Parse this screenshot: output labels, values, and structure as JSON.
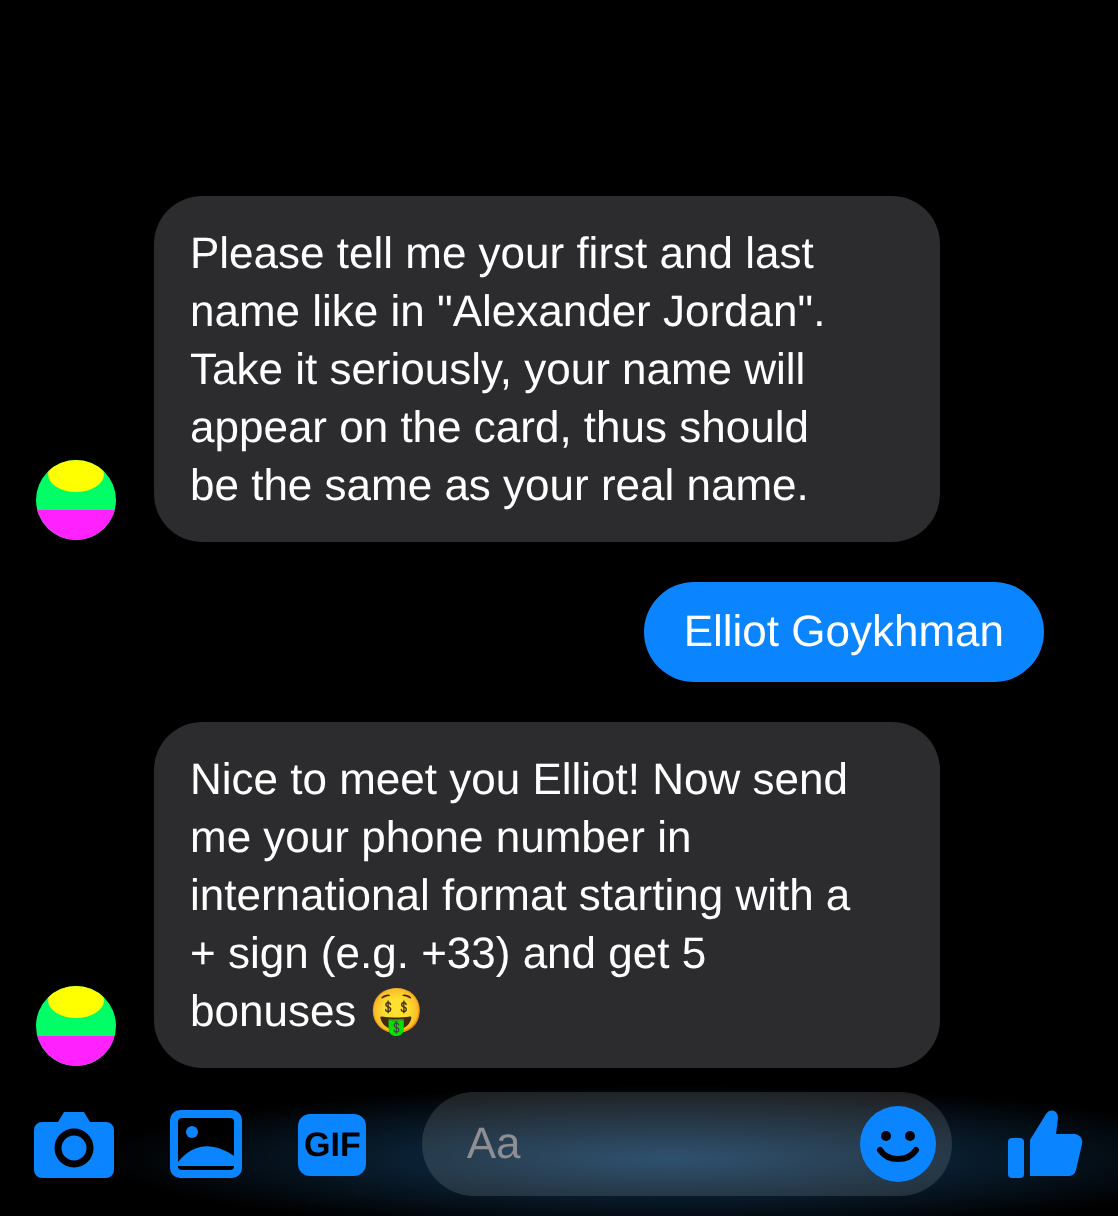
{
  "messages": [
    {
      "kind": "received",
      "text": "Please tell me your first and last name like in \"Alexander Jordan\".\nTake it seriously, your name will appear on the card, thus should be the same as your real name."
    },
    {
      "kind": "sent",
      "text": "Elliot Goykhman"
    },
    {
      "kind": "received",
      "text": "Nice to meet you Elliot! Now send me your phone number in international format starting with a + sign (e.g. +33) and get 5 bonuses 🤑"
    }
  ],
  "composer": {
    "gif_label": "GIF",
    "placeholder": "Aa"
  }
}
